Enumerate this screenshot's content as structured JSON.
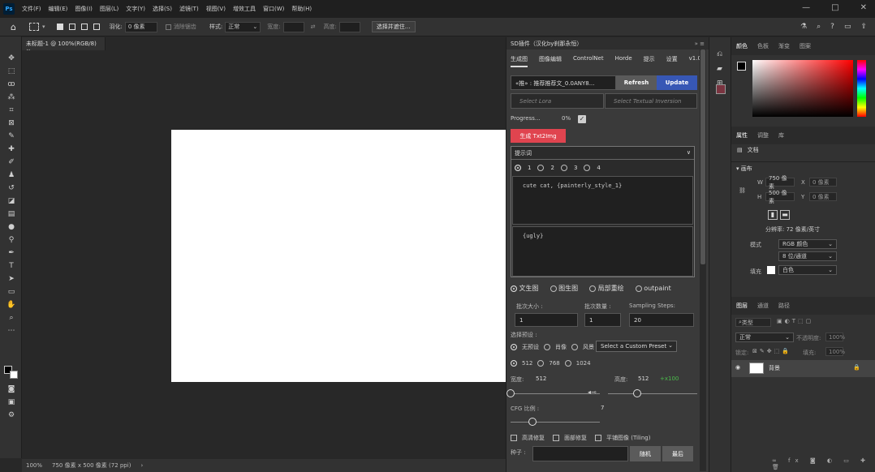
{
  "menubar": {
    "logo": "Ps",
    "items": [
      "文件(F)",
      "编辑(E)",
      "图像(I)",
      "图层(L)",
      "文字(Y)",
      "选择(S)",
      "滤镜(T)",
      "视图(V)",
      "增效工具",
      "窗口(W)",
      "帮助(H)"
    ],
    "window_controls": [
      "—",
      "□",
      "✕"
    ]
  },
  "options": {
    "feather_label": "羽化:",
    "feather_value": "0 像素",
    "antialias_label": "消除锯齿",
    "style_label": "样式:",
    "style_value": "正常",
    "width_label": "宽度:",
    "height_label": "高度:",
    "select_mask_btn": "选择并遮住..."
  },
  "document": {
    "tab_title": "未标题-1 @ 100%(RGB/8)",
    "status_zoom": "100%",
    "status_info": "750 像素 x 500 像素 (72 ppi)"
  },
  "sd": {
    "title": "SD插件（汉化by刹那永恒）",
    "tabs": [
      "生成图",
      "图像编辑",
      "ControlNet",
      "Horde",
      "提示",
      "设置",
      "v1.0"
    ],
    "model": "«推» : 推荐推荐文_0.0ANY8...",
    "refresh": "Refresh",
    "update": "Update",
    "select_lora": "Select Lora",
    "select_ti": "Select Textual Inversion",
    "progress_label": "Progress...",
    "progress_value": "0%",
    "generate_btn": "生成 Txt2Img",
    "prompt_header": "提示词",
    "prompt_tabs": [
      "1",
      "2",
      "3",
      "4"
    ],
    "positive_prompt": "cute cat, {painterly_style_1}",
    "negative_prompt": "{ugly}",
    "modes": [
      "文生图",
      "图生图",
      "局部重绘",
      "outpaint"
    ],
    "batch_size_label": "批次大小 :",
    "batch_size_value": "1",
    "batch_count_label": "批次数量 :",
    "batch_count_value": "1",
    "steps_label": "Sampling Steps:",
    "steps_value": "20",
    "preset_label": "选择预设 :",
    "preset_options": [
      "无预设",
      "肖像",
      "风景"
    ],
    "custom_preset": "Select a Custom Preset",
    "sizes": [
      "512",
      "768",
      "1024"
    ],
    "width_label": "宽度:",
    "width_value": "512",
    "height_label": "高度:",
    "height_value": "512",
    "ratio_value": "+x100",
    "cfg_label": "CFG 比例 :",
    "cfg_value": "7",
    "check_hires": "高清修复",
    "check_restore": "面部修复",
    "check_tiling": "平铺图像 (Tiling)",
    "seed_label": "种子 :",
    "random_btn": "随机",
    "last_btn": "最后"
  },
  "right": {
    "color_tabs": [
      "颜色",
      "色板",
      "渐变",
      "图案"
    ],
    "prop_tabs": [
      "属性",
      "调整",
      "库"
    ],
    "doc_label": "文档",
    "canvas_label": "画布",
    "w_value": "750 像素",
    "h_value": "500 像素",
    "x_placeholder": "0 像素",
    "y_placeholder": "0 像素",
    "resolution": "分辨率: 72 像素/英寸",
    "mode_label": "模式",
    "mode_value": "RGB 颜色",
    "bit_value": "8 位/通道",
    "fill_label": "填充",
    "fill_value": "白色",
    "layer_tabs": [
      "图层",
      "通道",
      "路径"
    ],
    "kind_placeholder": "类型",
    "blend_mode": "正常",
    "opacity_label": "不透明度:",
    "opacity_value": "100%",
    "lock_label": "锁定:",
    "fill2_label": "填充:",
    "fill2_value": "100%",
    "layer_name": "背景"
  }
}
